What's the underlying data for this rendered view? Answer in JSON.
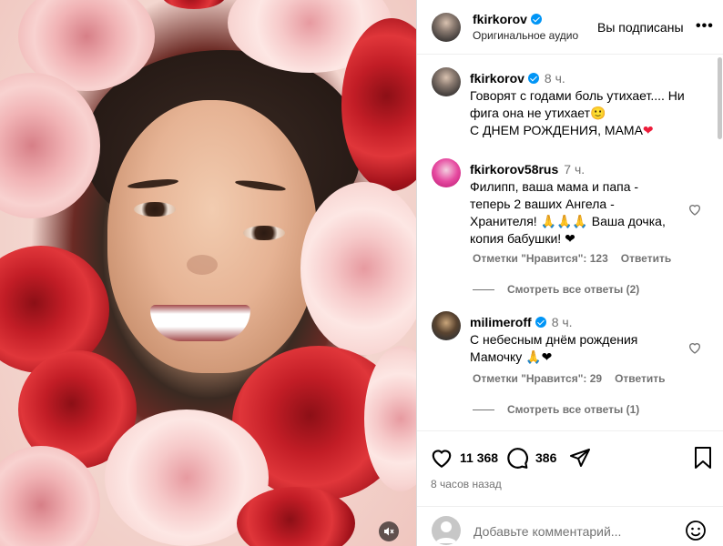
{
  "header": {
    "username": "fkirkorov",
    "subtitle": "Оригинальное аудио",
    "follow_label": "Вы подписаны",
    "more_label": "•••"
  },
  "caption": {
    "username": "fkirkorov",
    "time": "8 ч.",
    "line1": "Говорят с годами боль утихает.... Ни",
    "line2": "фига она не утихает🙂",
    "line3": "С ДНЕМ РОЖДЕНИЯ, МАМА",
    "heart": "❤"
  },
  "comments": [
    {
      "username": "fkirkorov58rus",
      "time": "7 ч.",
      "lines": [
        "Филипп, ваша мама и папа -",
        "теперь 2 ваших Ангела -",
        "Хранителя! 🙏🙏🙏 Ваша дочка,",
        "копия бабушки! ❤"
      ],
      "likes": "Отметки \"Нравится\": 123",
      "reply": "Ответить",
      "view_replies": "Смотреть все ответы (2)"
    },
    {
      "username": "milimeroff",
      "time": "8 ч.",
      "lines": [
        "С небесным днём рождения",
        "Мамочку 🙏❤"
      ],
      "likes": "Отметки \"Нравится\": 29",
      "reply": "Ответить",
      "view_replies": "Смотреть все ответы (1)"
    }
  ],
  "actions": {
    "likes_count": "11 368",
    "comments_count": "386",
    "time_ago": "8 часов назад"
  },
  "add_comment": {
    "placeholder": "Добавьте комментарий..."
  },
  "colors": {
    "verified": "#0095f6",
    "muted_text": "#737373",
    "heart_red": "#ed1c3a"
  }
}
